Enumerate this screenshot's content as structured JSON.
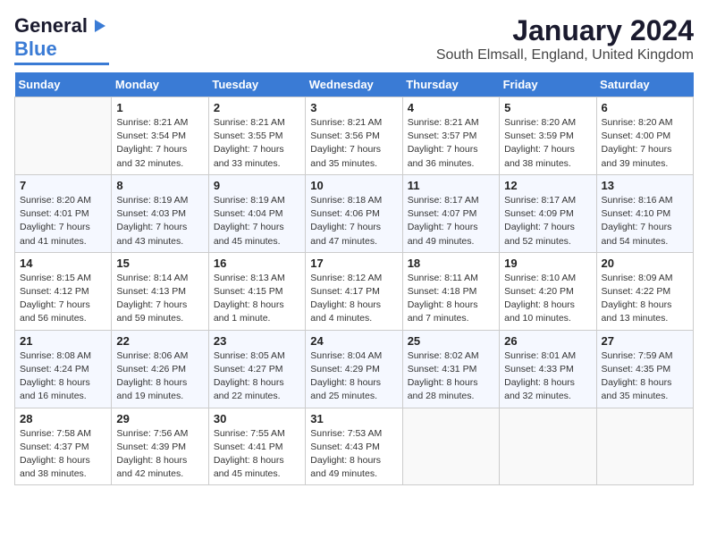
{
  "header": {
    "logo_line1": "General",
    "logo_line2": "Blue",
    "month": "January 2024",
    "location": "South Elmsall, England, United Kingdom"
  },
  "days_of_week": [
    "Sunday",
    "Monday",
    "Tuesday",
    "Wednesday",
    "Thursday",
    "Friday",
    "Saturday"
  ],
  "weeks": [
    [
      {
        "day": "",
        "sunrise": "",
        "sunset": "",
        "daylight": ""
      },
      {
        "day": "1",
        "sunrise": "Sunrise: 8:21 AM",
        "sunset": "Sunset: 3:54 PM",
        "daylight": "Daylight: 7 hours and 32 minutes."
      },
      {
        "day": "2",
        "sunrise": "Sunrise: 8:21 AM",
        "sunset": "Sunset: 3:55 PM",
        "daylight": "Daylight: 7 hours and 33 minutes."
      },
      {
        "day": "3",
        "sunrise": "Sunrise: 8:21 AM",
        "sunset": "Sunset: 3:56 PM",
        "daylight": "Daylight: 7 hours and 35 minutes."
      },
      {
        "day": "4",
        "sunrise": "Sunrise: 8:21 AM",
        "sunset": "Sunset: 3:57 PM",
        "daylight": "Daylight: 7 hours and 36 minutes."
      },
      {
        "day": "5",
        "sunrise": "Sunrise: 8:20 AM",
        "sunset": "Sunset: 3:59 PM",
        "daylight": "Daylight: 7 hours and 38 minutes."
      },
      {
        "day": "6",
        "sunrise": "Sunrise: 8:20 AM",
        "sunset": "Sunset: 4:00 PM",
        "daylight": "Daylight: 7 hours and 39 minutes."
      }
    ],
    [
      {
        "day": "7",
        "sunrise": "Sunrise: 8:20 AM",
        "sunset": "Sunset: 4:01 PM",
        "daylight": "Daylight: 7 hours and 41 minutes."
      },
      {
        "day": "8",
        "sunrise": "Sunrise: 8:19 AM",
        "sunset": "Sunset: 4:03 PM",
        "daylight": "Daylight: 7 hours and 43 minutes."
      },
      {
        "day": "9",
        "sunrise": "Sunrise: 8:19 AM",
        "sunset": "Sunset: 4:04 PM",
        "daylight": "Daylight: 7 hours and 45 minutes."
      },
      {
        "day": "10",
        "sunrise": "Sunrise: 8:18 AM",
        "sunset": "Sunset: 4:06 PM",
        "daylight": "Daylight: 7 hours and 47 minutes."
      },
      {
        "day": "11",
        "sunrise": "Sunrise: 8:17 AM",
        "sunset": "Sunset: 4:07 PM",
        "daylight": "Daylight: 7 hours and 49 minutes."
      },
      {
        "day": "12",
        "sunrise": "Sunrise: 8:17 AM",
        "sunset": "Sunset: 4:09 PM",
        "daylight": "Daylight: 7 hours and 52 minutes."
      },
      {
        "day": "13",
        "sunrise": "Sunrise: 8:16 AM",
        "sunset": "Sunset: 4:10 PM",
        "daylight": "Daylight: 7 hours and 54 minutes."
      }
    ],
    [
      {
        "day": "14",
        "sunrise": "Sunrise: 8:15 AM",
        "sunset": "Sunset: 4:12 PM",
        "daylight": "Daylight: 7 hours and 56 minutes."
      },
      {
        "day": "15",
        "sunrise": "Sunrise: 8:14 AM",
        "sunset": "Sunset: 4:13 PM",
        "daylight": "Daylight: 7 hours and 59 minutes."
      },
      {
        "day": "16",
        "sunrise": "Sunrise: 8:13 AM",
        "sunset": "Sunset: 4:15 PM",
        "daylight": "Daylight: 8 hours and 1 minute."
      },
      {
        "day": "17",
        "sunrise": "Sunrise: 8:12 AM",
        "sunset": "Sunset: 4:17 PM",
        "daylight": "Daylight: 8 hours and 4 minutes."
      },
      {
        "day": "18",
        "sunrise": "Sunrise: 8:11 AM",
        "sunset": "Sunset: 4:18 PM",
        "daylight": "Daylight: 8 hours and 7 minutes."
      },
      {
        "day": "19",
        "sunrise": "Sunrise: 8:10 AM",
        "sunset": "Sunset: 4:20 PM",
        "daylight": "Daylight: 8 hours and 10 minutes."
      },
      {
        "day": "20",
        "sunrise": "Sunrise: 8:09 AM",
        "sunset": "Sunset: 4:22 PM",
        "daylight": "Daylight: 8 hours and 13 minutes."
      }
    ],
    [
      {
        "day": "21",
        "sunrise": "Sunrise: 8:08 AM",
        "sunset": "Sunset: 4:24 PM",
        "daylight": "Daylight: 8 hours and 16 minutes."
      },
      {
        "day": "22",
        "sunrise": "Sunrise: 8:06 AM",
        "sunset": "Sunset: 4:26 PM",
        "daylight": "Daylight: 8 hours and 19 minutes."
      },
      {
        "day": "23",
        "sunrise": "Sunrise: 8:05 AM",
        "sunset": "Sunset: 4:27 PM",
        "daylight": "Daylight: 8 hours and 22 minutes."
      },
      {
        "day": "24",
        "sunrise": "Sunrise: 8:04 AM",
        "sunset": "Sunset: 4:29 PM",
        "daylight": "Daylight: 8 hours and 25 minutes."
      },
      {
        "day": "25",
        "sunrise": "Sunrise: 8:02 AM",
        "sunset": "Sunset: 4:31 PM",
        "daylight": "Daylight: 8 hours and 28 minutes."
      },
      {
        "day": "26",
        "sunrise": "Sunrise: 8:01 AM",
        "sunset": "Sunset: 4:33 PM",
        "daylight": "Daylight: 8 hours and 32 minutes."
      },
      {
        "day": "27",
        "sunrise": "Sunrise: 7:59 AM",
        "sunset": "Sunset: 4:35 PM",
        "daylight": "Daylight: 8 hours and 35 minutes."
      }
    ],
    [
      {
        "day": "28",
        "sunrise": "Sunrise: 7:58 AM",
        "sunset": "Sunset: 4:37 PM",
        "daylight": "Daylight: 8 hours and 38 minutes."
      },
      {
        "day": "29",
        "sunrise": "Sunrise: 7:56 AM",
        "sunset": "Sunset: 4:39 PM",
        "daylight": "Daylight: 8 hours and 42 minutes."
      },
      {
        "day": "30",
        "sunrise": "Sunrise: 7:55 AM",
        "sunset": "Sunset: 4:41 PM",
        "daylight": "Daylight: 8 hours and 45 minutes."
      },
      {
        "day": "31",
        "sunrise": "Sunrise: 7:53 AM",
        "sunset": "Sunset: 4:43 PM",
        "daylight": "Daylight: 8 hours and 49 minutes."
      },
      {
        "day": "",
        "sunrise": "",
        "sunset": "",
        "daylight": ""
      },
      {
        "day": "",
        "sunrise": "",
        "sunset": "",
        "daylight": ""
      },
      {
        "day": "",
        "sunrise": "",
        "sunset": "",
        "daylight": ""
      }
    ]
  ]
}
